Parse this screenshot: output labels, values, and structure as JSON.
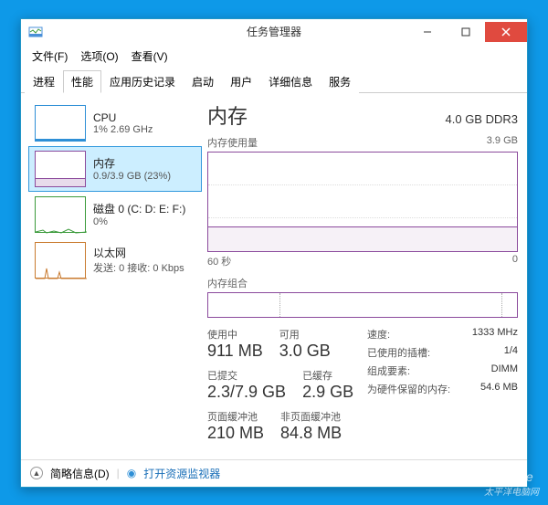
{
  "window": {
    "title": "任务管理器"
  },
  "menubar": [
    "文件(F)",
    "选项(O)",
    "查看(V)"
  ],
  "tabs": [
    "进程",
    "性能",
    "应用历史记录",
    "启动",
    "用户",
    "详细信息",
    "服务"
  ],
  "active_tab_index": 1,
  "sidebar": {
    "selected_index": 1,
    "items": [
      {
        "title": "CPU",
        "subtitle": "1% 2.69 GHz",
        "color": "#2e8fd6"
      },
      {
        "title": "内存",
        "subtitle": "0.9/3.9 GB (23%)",
        "color": "#8b4a9c"
      },
      {
        "title": "磁盘 0 (C: D: E: F:)",
        "subtitle": "0%",
        "color": "#3a9a3a"
      },
      {
        "title": "以太网",
        "subtitle": "发送: 0 接收: 0 Kbps",
        "color": "#c97a2e"
      }
    ]
  },
  "main": {
    "title": "内存",
    "subtitle": "4.0 GB DDR3",
    "usage_label": "内存使用量",
    "usage_max": "3.9 GB",
    "time_left": "60 秒",
    "time_right": "0",
    "composition_label": "内存组合",
    "stats_left": [
      [
        {
          "label": "使用中",
          "value": "911 MB"
        },
        {
          "label": "可用",
          "value": "3.0 GB"
        }
      ],
      [
        {
          "label": "已提交",
          "value": "2.3/7.9 GB"
        },
        {
          "label": "已缓存",
          "value": "2.9 GB"
        }
      ],
      [
        {
          "label": "页面缓冲池",
          "value": "210 MB"
        },
        {
          "label": "非页面缓冲池",
          "value": "84.8 MB"
        }
      ]
    ],
    "stats_right": [
      {
        "k": "速度:",
        "v": "1333 MHz"
      },
      {
        "k": "已使用的插槽:",
        "v": "1/4"
      },
      {
        "k": "组成要素:",
        "v": "DIMM"
      },
      {
        "k": "为硬件保留的内存:",
        "v": "54.6 MB"
      }
    ]
  },
  "footer": {
    "fewer": "简略信息(D)",
    "resmon": "打开资源监视器"
  },
  "watermark": {
    "en": "Pconline",
    "cn": "太平洋电脑网"
  }
}
